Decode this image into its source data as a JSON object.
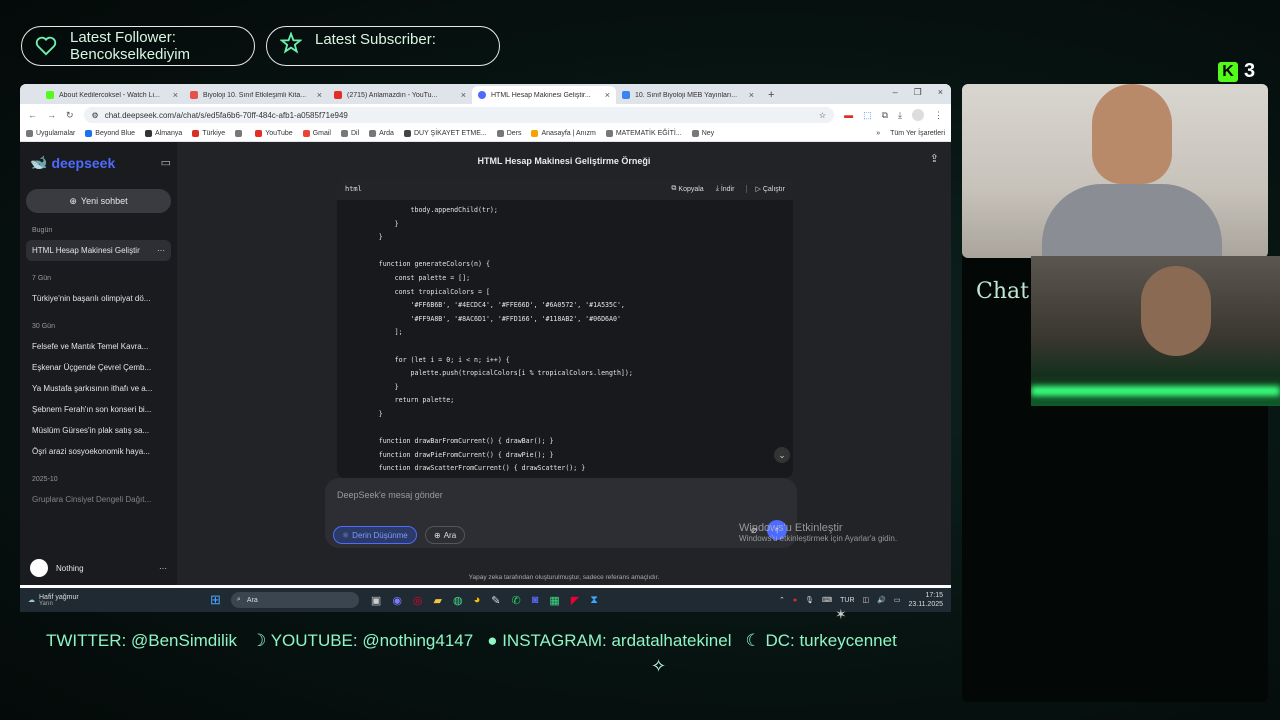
{
  "alerts": {
    "follower_label": "Latest Follower:",
    "follower_name": "Bencokselkediyim",
    "subscriber_label": "Latest Subscriber:",
    "subscriber_name": ""
  },
  "kick_badge": {
    "logo": "K",
    "count": "3"
  },
  "chat_label": "Chat",
  "browser": {
    "tabs": [
      {
        "title": "About Kedilercoksel - Watch Li...",
        "color": "#53fc18",
        "active": false
      },
      {
        "title": "Biyoloji 10. Sınıf Etkileşimli Kita...",
        "color": "#e6524b",
        "active": false
      },
      {
        "title": "(2715) Anlamazdın - YouTu...",
        "color": "#e52d27",
        "active": false
      },
      {
        "title": "HTML Hesap Makinesi Geliştir...",
        "color": "#4d6bfe",
        "active": true
      },
      {
        "title": "10. Sınıf Biyoloji MEB Yayınları...",
        "color": "#3b82f6",
        "active": false
      }
    ],
    "url": "chat.deepseek.com/a/chat/s/ed5fa6b6-70ff-484c-afb1-a0585f71e949",
    "bookmarks": [
      {
        "label": "Uygulamalar",
        "color": "#777"
      },
      {
        "label": "Beyond Blue",
        "color": "#1a73e8"
      },
      {
        "label": "Almanya",
        "color": "#333"
      },
      {
        "label": "Türkiye",
        "color": "#d93025"
      },
      {
        "label": "",
        "color": "#777"
      },
      {
        "label": "YouTube",
        "color": "#e52d27"
      },
      {
        "label": "Gmail",
        "color": "#ea4335"
      },
      {
        "label": "Dil",
        "color": "#777"
      },
      {
        "label": "Arda",
        "color": "#777"
      },
      {
        "label": "DUY ŞİKAYET ETME...",
        "color": "#444"
      },
      {
        "label": "Ders",
        "color": "#777"
      },
      {
        "label": "Anasayfa | Anızm",
        "color": "#f4a300"
      },
      {
        "label": "MATEMATİK EĞİTİ...",
        "color": "#777"
      },
      {
        "label": "Ney",
        "color": "#777"
      }
    ],
    "bookmarks_more": "»",
    "all_bookmarks": "Tüm Yer İşaretleri"
  },
  "deepseek": {
    "logo": "deepseek",
    "new_chat": "Yeni sohbet",
    "groups": [
      {
        "label": "Bugün",
        "items": [
          "HTML Hesap Makinesi Geliştir"
        ]
      },
      {
        "label": "7 Gün",
        "items": [
          "Türkiye'nin başarılı olimpiyat dö..."
        ]
      },
      {
        "label": "30 Gün",
        "items": [
          "Felsefe ve Mantık Temel Kavra...",
          "Eşkenar Üçgende Çevrel Çemb...",
          "Ya Mustafa şarkısının ithafı ve a...",
          "Şebnem Ferah'ın son konseri bi...",
          "Müslüm Gürses'in plak satış sa...",
          "Öşri arazi sosyoekonomik haya..."
        ]
      },
      {
        "label": "2025-10",
        "items": [
          "Gruplara Cinsiyet Dengeli Dağıt..."
        ]
      }
    ],
    "user_name": "Nothing",
    "chat_title": "HTML Hesap Makinesi Geliştirme Örneği",
    "code_lang": "html",
    "code_actions": {
      "copy": "Kopyala",
      "download": "İndir",
      "run": "Çalıştır"
    },
    "code": "                tbody.appendChild(tr);\n            }\n        }\n\n        function generateColors(n) {\n            const palette = [];\n            const tropicalColors = [\n                '#FF6B6B', '#4ECDC4', '#FFE66D', '#6A0572', '#1A535C',\n                '#FF9A8B', '#8AC6D1', '#FFD166', '#118AB2', '#06D6A0'\n            ];\n\n            for (let i = 0; i < n; i++) {\n                palette.push(tropicalColors[i % tropicalColors.length]);\n            }\n            return palette;\n        }\n\n        function drawBarFromCurrent() { drawBar(); }\n        function drawPieFromCurrent() { drawPie(); }\n        function drawScatterFromCurrent() { drawScatter(); }",
    "input_placeholder": "DeepSeek'e mesaj gönder",
    "deep_think": "Derin Düşünme",
    "search": "Ara",
    "disclaimer": "Yapay zeka tarafından oluşturulmuştur, sadece referans amaçlıdır.",
    "watermark_title": "Windows'u Etkinleştir",
    "watermark_sub": "Windows'u etkinleştirmek için Ayarlar'a gidin."
  },
  "taskbar": {
    "weather": "Hafif yağmur",
    "weather_sub": "Yarın",
    "search": "Ara",
    "lang": "TUR",
    "time": "17:15",
    "date": "23.11.2025"
  },
  "socials": {
    "twitter": "TWITTER: @BenSimdilik",
    "youtube": "YOUTUBE: @nothing4147",
    "instagram": "INSTAGRAM: ardatalhatekinel",
    "dc": "DC: turkeycennet"
  }
}
